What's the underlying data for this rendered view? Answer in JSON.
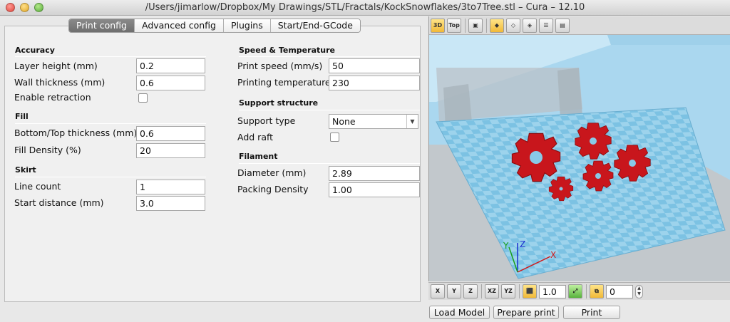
{
  "window": {
    "title": "/Users/jimarlow/Dropbox/My Drawings/STL/Fractals/KockSnowflakes/3to7Tree.stl – Cura – 12.10"
  },
  "tabs": [
    {
      "label": "Print config",
      "active": true
    },
    {
      "label": "Advanced config",
      "active": false
    },
    {
      "label": "Plugins",
      "active": false
    },
    {
      "label": "Start/End-GCode",
      "active": false
    }
  ],
  "accuracy": {
    "title": "Accuracy",
    "layer_height": {
      "label": "Layer height (mm)",
      "value": "0.2"
    },
    "wall_thickness": {
      "label": "Wall thickness (mm)",
      "value": "0.6"
    },
    "enable_retraction": {
      "label": "Enable retraction",
      "checked": false
    }
  },
  "fill": {
    "title": "Fill",
    "bottom_top_thickness": {
      "label": "Bottom/Top thickness (mm)",
      "value": "0.6"
    },
    "fill_density": {
      "label": "Fill Density (%)",
      "value": "20"
    }
  },
  "skirt": {
    "title": "Skirt",
    "line_count": {
      "label": "Line count",
      "value": "1"
    },
    "start_distance": {
      "label": "Start distance (mm)",
      "value": "3.0"
    }
  },
  "speed": {
    "title": "Speed & Temperature",
    "print_speed": {
      "label": "Print speed (mm/s)",
      "value": "50"
    },
    "print_temp": {
      "label": "Printing temperature",
      "value": "230"
    }
  },
  "support": {
    "title": "Support structure",
    "support_type": {
      "label": "Support type",
      "value": "None"
    },
    "add_raft": {
      "label": "Add raft",
      "checked": false
    }
  },
  "filament": {
    "title": "Filament",
    "diameter": {
      "label": "Diameter (mm)",
      "value": "2.89"
    },
    "packing_density": {
      "label": "Packing Density",
      "value": "1.00"
    }
  },
  "viewport": {
    "top_toolbar": {
      "view3d_label": "3D",
      "viewtop_label": "Top"
    },
    "axes": {
      "x": "X",
      "y": "Y",
      "z": "Z"
    },
    "bottom_toolbar": {
      "rot_x": "X",
      "rot_y": "Y",
      "rot_z": "Z",
      "mirror_xz": "XZ",
      "mirror_yz": "YZ",
      "scale_value": "1.0",
      "copies_value": "0"
    }
  },
  "actions": {
    "load_model": "Load Model",
    "prepare_print": "Prepare print",
    "print": "Print"
  },
  "colors": {
    "bed": "#7fc4e4",
    "model": "#c8161c",
    "tab_active": "#7a7a7a"
  }
}
